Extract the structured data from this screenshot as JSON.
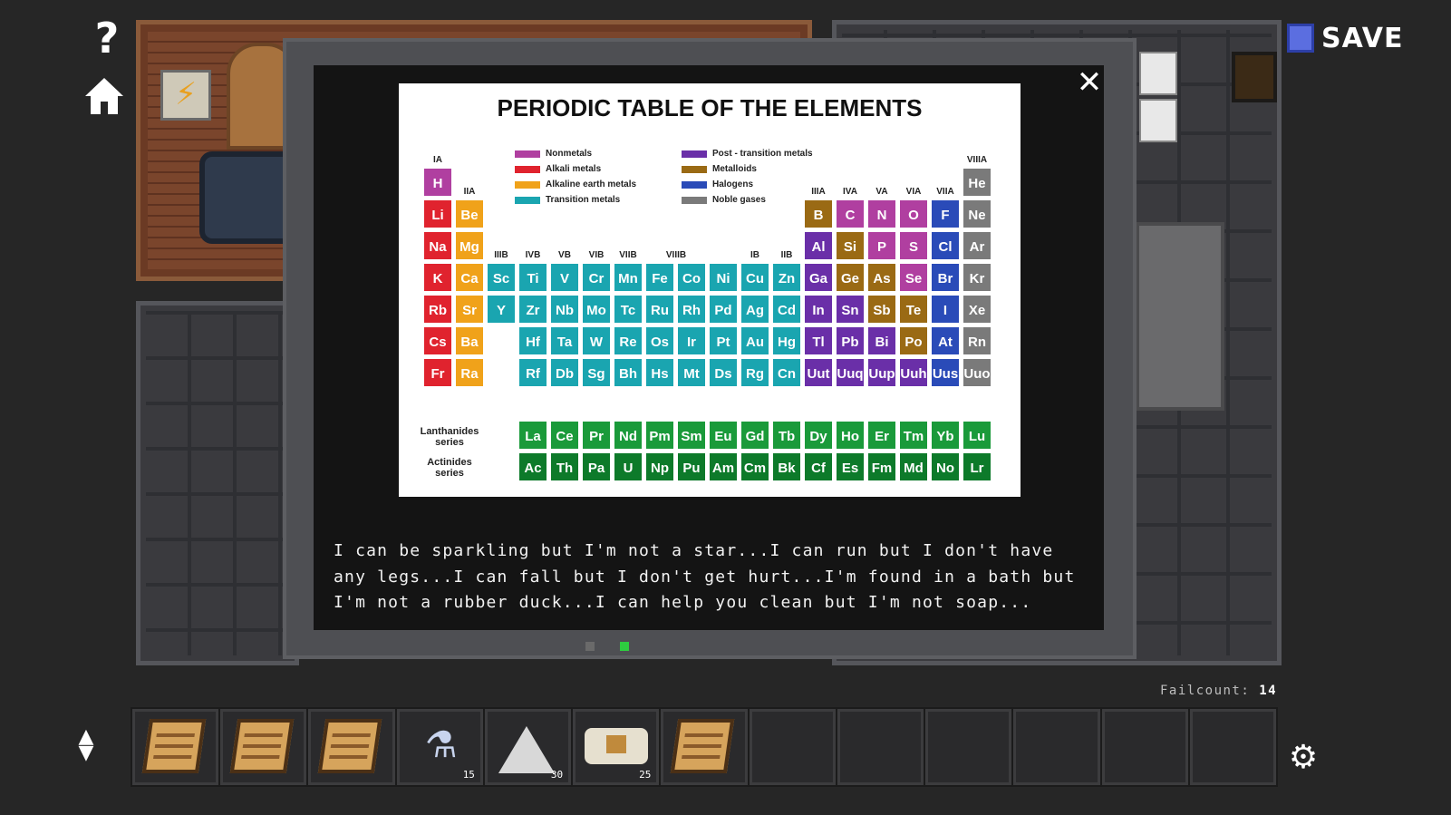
{
  "hud": {
    "help_icon": "question-mark-icon",
    "home_icon": "home-icon",
    "save_label": "SAVE",
    "save_icon": "floppy-disk-icon",
    "failcount_label": "Failcount:",
    "failcount_value": "14",
    "settings_icon": "gear-icon",
    "toggle_icon": "up-down-arrows-icon"
  },
  "modal": {
    "close_icon": "close-icon",
    "riddle": "I can be sparkling but I'm not a star...I can run but I don't have any legs...I can fall but I don't get hurt...I'm found in a bath but I'm not a rubber duck...I can help you clean but I'm not soap..."
  },
  "periodic_table": {
    "title": "PERIODIC TABLE OF THE ELEMENTS",
    "legend": [
      {
        "label": "Nonmetals",
        "color": "#b03fa0"
      },
      {
        "label": "Alkali metals",
        "color": "#e0232e"
      },
      {
        "label": "Alkaline earth metals",
        "color": "#f0a21a"
      },
      {
        "label": "Transition metals",
        "color": "#1aa5b0"
      },
      {
        "label": "Post - transition metals",
        "color": "#6a2fa8"
      },
      {
        "label": "Metalloids",
        "color": "#9a6a14"
      },
      {
        "label": "Halogens",
        "color": "#2a4bb8"
      },
      {
        "label": "Noble gases",
        "color": "#7a7a7a"
      }
    ],
    "groups": [
      "IA",
      "IIA",
      "IIIB",
      "IVB",
      "VB",
      "VIB",
      "VIIB",
      "VIIIB",
      "IB",
      "IIB",
      "IIIA",
      "IVA",
      "VA",
      "VIA",
      "VIIA",
      "VIIIA"
    ],
    "series_labels": [
      "Lanthanides series",
      "Actinides series"
    ],
    "elements": [
      {
        "s": "H",
        "r": 0,
        "c": 0,
        "k": "non"
      },
      {
        "s": "He",
        "r": 0,
        "c": 17,
        "k": "noble"
      },
      {
        "s": "Li",
        "r": 1,
        "c": 0,
        "k": "alk"
      },
      {
        "s": "Be",
        "r": 1,
        "c": 1,
        "k": "ae"
      },
      {
        "s": "B",
        "r": 1,
        "c": 12,
        "k": "met"
      },
      {
        "s": "C",
        "r": 1,
        "c": 13,
        "k": "non"
      },
      {
        "s": "N",
        "r": 1,
        "c": 14,
        "k": "non"
      },
      {
        "s": "O",
        "r": 1,
        "c": 15,
        "k": "non"
      },
      {
        "s": "F",
        "r": 1,
        "c": 16,
        "k": "hal"
      },
      {
        "s": "Ne",
        "r": 1,
        "c": 17,
        "k": "noble"
      },
      {
        "s": "Na",
        "r": 2,
        "c": 0,
        "k": "alk"
      },
      {
        "s": "Mg",
        "r": 2,
        "c": 1,
        "k": "ae"
      },
      {
        "s": "Al",
        "r": 2,
        "c": 12,
        "k": "post"
      },
      {
        "s": "Si",
        "r": 2,
        "c": 13,
        "k": "met"
      },
      {
        "s": "P",
        "r": 2,
        "c": 14,
        "k": "non"
      },
      {
        "s": "S",
        "r": 2,
        "c": 15,
        "k": "non"
      },
      {
        "s": "Cl",
        "r": 2,
        "c": 16,
        "k": "hal"
      },
      {
        "s": "Ar",
        "r": 2,
        "c": 17,
        "k": "noble"
      },
      {
        "s": "K",
        "r": 3,
        "c": 0,
        "k": "alk"
      },
      {
        "s": "Ca",
        "r": 3,
        "c": 1,
        "k": "ae"
      },
      {
        "s": "Sc",
        "r": 3,
        "c": 2,
        "k": "tr"
      },
      {
        "s": "Ti",
        "r": 3,
        "c": 3,
        "k": "tr"
      },
      {
        "s": "V",
        "r": 3,
        "c": 4,
        "k": "tr"
      },
      {
        "s": "Cr",
        "r": 3,
        "c": 5,
        "k": "tr"
      },
      {
        "s": "Mn",
        "r": 3,
        "c": 6,
        "k": "tr"
      },
      {
        "s": "Fe",
        "r": 3,
        "c": 7,
        "k": "tr"
      },
      {
        "s": "Co",
        "r": 3,
        "c": 8,
        "k": "tr"
      },
      {
        "s": "Ni",
        "r": 3,
        "c": 9,
        "k": "tr"
      },
      {
        "s": "Cu",
        "r": 3,
        "c": 10,
        "k": "tr"
      },
      {
        "s": "Zn",
        "r": 3,
        "c": 11,
        "k": "tr"
      },
      {
        "s": "Ga",
        "r": 3,
        "c": 12,
        "k": "post"
      },
      {
        "s": "Ge",
        "r": 3,
        "c": 13,
        "k": "met"
      },
      {
        "s": "As",
        "r": 3,
        "c": 14,
        "k": "met"
      },
      {
        "s": "Se",
        "r": 3,
        "c": 15,
        "k": "non"
      },
      {
        "s": "Br",
        "r": 3,
        "c": 16,
        "k": "hal"
      },
      {
        "s": "Kr",
        "r": 3,
        "c": 17,
        "k": "noble"
      },
      {
        "s": "Rb",
        "r": 4,
        "c": 0,
        "k": "alk"
      },
      {
        "s": "Sr",
        "r": 4,
        "c": 1,
        "k": "ae"
      },
      {
        "s": "Y",
        "r": 4,
        "c": 2,
        "k": "tr"
      },
      {
        "s": "Zr",
        "r": 4,
        "c": 3,
        "k": "tr"
      },
      {
        "s": "Nb",
        "r": 4,
        "c": 4,
        "k": "tr"
      },
      {
        "s": "Mo",
        "r": 4,
        "c": 5,
        "k": "tr"
      },
      {
        "s": "Tc",
        "r": 4,
        "c": 6,
        "k": "tr"
      },
      {
        "s": "Ru",
        "r": 4,
        "c": 7,
        "k": "tr"
      },
      {
        "s": "Rh",
        "r": 4,
        "c": 8,
        "k": "tr"
      },
      {
        "s": "Pd",
        "r": 4,
        "c": 9,
        "k": "tr"
      },
      {
        "s": "Ag",
        "r": 4,
        "c": 10,
        "k": "tr"
      },
      {
        "s": "Cd",
        "r": 4,
        "c": 11,
        "k": "tr"
      },
      {
        "s": "In",
        "r": 4,
        "c": 12,
        "k": "post"
      },
      {
        "s": "Sn",
        "r": 4,
        "c": 13,
        "k": "post"
      },
      {
        "s": "Sb",
        "r": 4,
        "c": 14,
        "k": "met"
      },
      {
        "s": "Te",
        "r": 4,
        "c": 15,
        "k": "met"
      },
      {
        "s": "I",
        "r": 4,
        "c": 16,
        "k": "hal"
      },
      {
        "s": "Xe",
        "r": 4,
        "c": 17,
        "k": "noble"
      },
      {
        "s": "Cs",
        "r": 5,
        "c": 0,
        "k": "alk"
      },
      {
        "s": "Ba",
        "r": 5,
        "c": 1,
        "k": "ae"
      },
      {
        "s": "Hf",
        "r": 5,
        "c": 3,
        "k": "tr"
      },
      {
        "s": "Ta",
        "r": 5,
        "c": 4,
        "k": "tr"
      },
      {
        "s": "W",
        "r": 5,
        "c": 5,
        "k": "tr"
      },
      {
        "s": "Re",
        "r": 5,
        "c": 6,
        "k": "tr"
      },
      {
        "s": "Os",
        "r": 5,
        "c": 7,
        "k": "tr"
      },
      {
        "s": "Ir",
        "r": 5,
        "c": 8,
        "k": "tr"
      },
      {
        "s": "Pt",
        "r": 5,
        "c": 9,
        "k": "tr"
      },
      {
        "s": "Au",
        "r": 5,
        "c": 10,
        "k": "tr"
      },
      {
        "s": "Hg",
        "r": 5,
        "c": 11,
        "k": "tr"
      },
      {
        "s": "Tl",
        "r": 5,
        "c": 12,
        "k": "post"
      },
      {
        "s": "Pb",
        "r": 5,
        "c": 13,
        "k": "post"
      },
      {
        "s": "Bi",
        "r": 5,
        "c": 14,
        "k": "post"
      },
      {
        "s": "Po",
        "r": 5,
        "c": 15,
        "k": "met"
      },
      {
        "s": "At",
        "r": 5,
        "c": 16,
        "k": "hal"
      },
      {
        "s": "Rn",
        "r": 5,
        "c": 17,
        "k": "noble"
      },
      {
        "s": "Fr",
        "r": 6,
        "c": 0,
        "k": "alk"
      },
      {
        "s": "Ra",
        "r": 6,
        "c": 1,
        "k": "ae"
      },
      {
        "s": "Rf",
        "r": 6,
        "c": 3,
        "k": "tr"
      },
      {
        "s": "Db",
        "r": 6,
        "c": 4,
        "k": "tr"
      },
      {
        "s": "Sg",
        "r": 6,
        "c": 5,
        "k": "tr"
      },
      {
        "s": "Bh",
        "r": 6,
        "c": 6,
        "k": "tr"
      },
      {
        "s": "Hs",
        "r": 6,
        "c": 7,
        "k": "tr"
      },
      {
        "s": "Mt",
        "r": 6,
        "c": 8,
        "k": "tr"
      },
      {
        "s": "Ds",
        "r": 6,
        "c": 9,
        "k": "tr"
      },
      {
        "s": "Rg",
        "r": 6,
        "c": 10,
        "k": "tr"
      },
      {
        "s": "Cn",
        "r": 6,
        "c": 11,
        "k": "tr"
      },
      {
        "s": "Uut",
        "r": 6,
        "c": 12,
        "k": "post"
      },
      {
        "s": "Uuq",
        "r": 6,
        "c": 13,
        "k": "post"
      },
      {
        "s": "Uup",
        "r": 6,
        "c": 14,
        "k": "post"
      },
      {
        "s": "Uuh",
        "r": 6,
        "c": 15,
        "k": "post"
      },
      {
        "s": "Uus",
        "r": 6,
        "c": 16,
        "k": "hal"
      },
      {
        "s": "Uuo",
        "r": 6,
        "c": 17,
        "k": "noble"
      }
    ],
    "lanthanides": [
      "La",
      "Ce",
      "Pr",
      "Nd",
      "Pm",
      "Sm",
      "Eu",
      "Gd",
      "Tb",
      "Dy",
      "Ho",
      "Er",
      "Tm",
      "Yb",
      "Lu"
    ],
    "actinides": [
      "Ac",
      "Th",
      "Pa",
      "U",
      "Np",
      "Pu",
      "Am",
      "Cm",
      "Bk",
      "Cf",
      "Es",
      "Fm",
      "Md",
      "No",
      "Lr"
    ],
    "colors": {
      "non": "#b03fa0",
      "alk": "#e0232e",
      "ae": "#f0a21a",
      "tr": "#1aa5b0",
      "post": "#6a2fa8",
      "met": "#9a6a14",
      "hal": "#2a4bb8",
      "noble": "#7a7a7a",
      "lan": "#1a9a3a"
    }
  },
  "inventory": [
    {
      "item": "scroll-icon",
      "qty": ""
    },
    {
      "item": "scroll-icon",
      "qty": ""
    },
    {
      "item": "scroll-icon",
      "qty": ""
    },
    {
      "item": "flask-icon",
      "qty": "15"
    },
    {
      "item": "salt-pile-icon",
      "qty": "30"
    },
    {
      "item": "cheese-cloth-icon",
      "qty": "25"
    },
    {
      "item": "scroll-icon",
      "qty": ""
    },
    {
      "item": "",
      "qty": ""
    },
    {
      "item": "",
      "qty": ""
    },
    {
      "item": "",
      "qty": ""
    },
    {
      "item": "",
      "qty": ""
    },
    {
      "item": "",
      "qty": ""
    },
    {
      "item": "",
      "qty": ""
    }
  ]
}
